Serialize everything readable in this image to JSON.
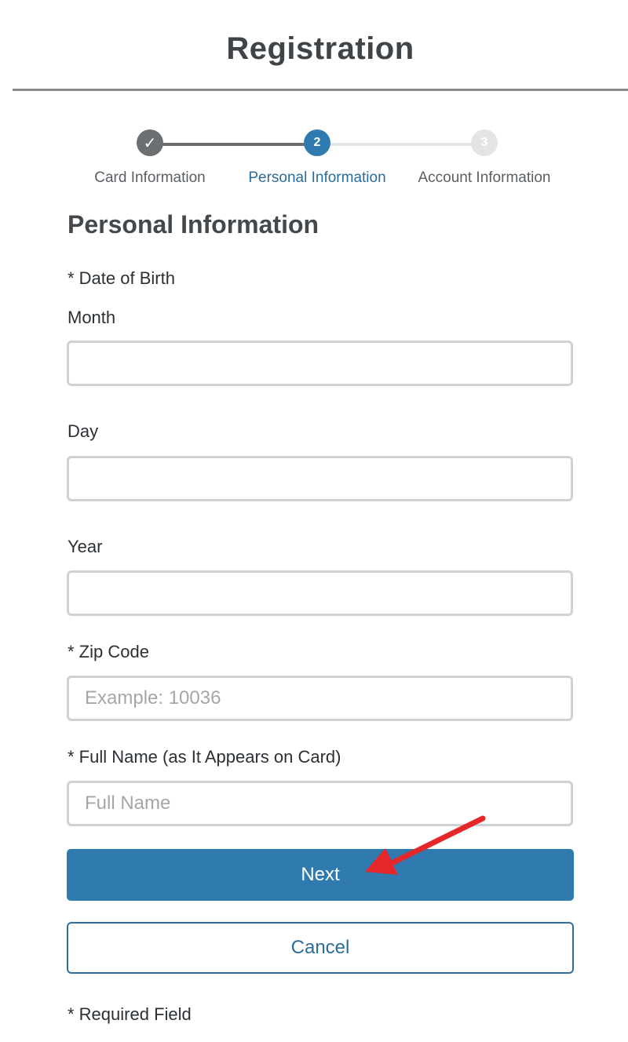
{
  "page": {
    "title": "Registration"
  },
  "stepper": {
    "steps": [
      {
        "label": "Card Information",
        "marker": "✓",
        "state": "completed"
      },
      {
        "label": "Personal Information",
        "marker": "2",
        "state": "active"
      },
      {
        "label": "Account Information",
        "marker": "3",
        "state": "upcoming"
      }
    ]
  },
  "form": {
    "heading": "Personal Information",
    "dob_label": "* Date of Birth",
    "month": {
      "label": "Month",
      "value": "",
      "placeholder": ""
    },
    "day": {
      "label": "Day",
      "value": "",
      "placeholder": ""
    },
    "year": {
      "label": "Year",
      "value": "",
      "placeholder": ""
    },
    "zip": {
      "label": "* Zip Code",
      "value": "",
      "placeholder": "Example: 10036"
    },
    "full_name": {
      "label": "* Full Name (as It Appears on Card)",
      "value": "",
      "placeholder": "Full Name"
    },
    "next_label": "Next",
    "cancel_label": "Cancel",
    "required_note": "* Required Field"
  },
  "colors": {
    "primary": "#2f7bb0",
    "step_done": "#6c6f72",
    "step_todo": "#e2e4e6",
    "annotation_arrow": "#e5262a"
  },
  "icons": {
    "completed_step": "check-icon",
    "annotation": "red-arrow-pointer"
  }
}
